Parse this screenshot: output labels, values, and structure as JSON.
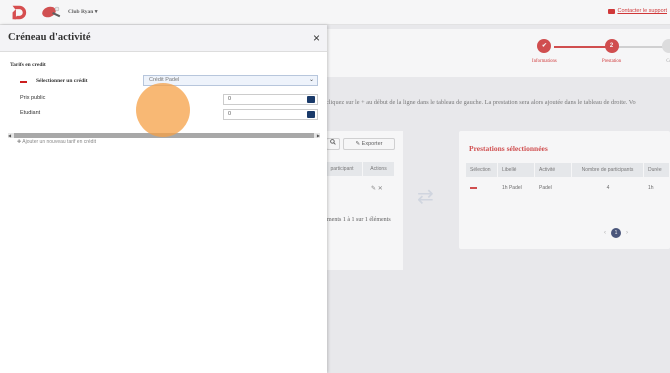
{
  "topbar": {
    "club_name": "Club Ryan",
    "club_chevron": "▾",
    "support_link": "Contacter le support"
  },
  "steps": [
    {
      "label": "Informations",
      "icon": "✔"
    },
    {
      "label": "Prestation",
      "icon": "2"
    },
    {
      "label": "Co",
      "icon": ""
    }
  ],
  "instruction": "cliquez sur le + au début de la ligne dans le tableau de gauche. La prestation sera alors ajoutée dans le tableau de droite. Vo",
  "left_table": {
    "search_icon": "magnifier-icon",
    "export_label": "✎ Exporter",
    "columns": [
      "participant",
      "Actions"
    ],
    "info": "ments 1 à 1 sur 1 éléments"
  },
  "selected": {
    "title": "Prestations sélectionnées",
    "columns": [
      "Sélection",
      "Libellé",
      "Activité",
      "Nombre de participants",
      "Durée"
    ],
    "rows": [
      {
        "libelle": "1h Padel",
        "activite": "Padel",
        "participants": "4",
        "duree": "1h"
      }
    ],
    "pager_prev": "‹",
    "pager_current": "1",
    "pager_next": "›"
  },
  "modal": {
    "title": "Créneau d'activité",
    "close": "×",
    "section": "Tarifs en credit",
    "select_label": "Sélectionner un crédit",
    "select_value": "Crédit Padel",
    "select_chevron": "⌄",
    "prices": [
      {
        "label": "Prix public",
        "value": "0"
      },
      {
        "label": "Etudiant",
        "value": "0"
      }
    ],
    "add_link": "✚ Ajouter un nouveau tarif en crédit"
  },
  "colors": {
    "accent": "#cc1f1f",
    "highlight": "#f5a046",
    "navy": "#1a2a5a"
  }
}
